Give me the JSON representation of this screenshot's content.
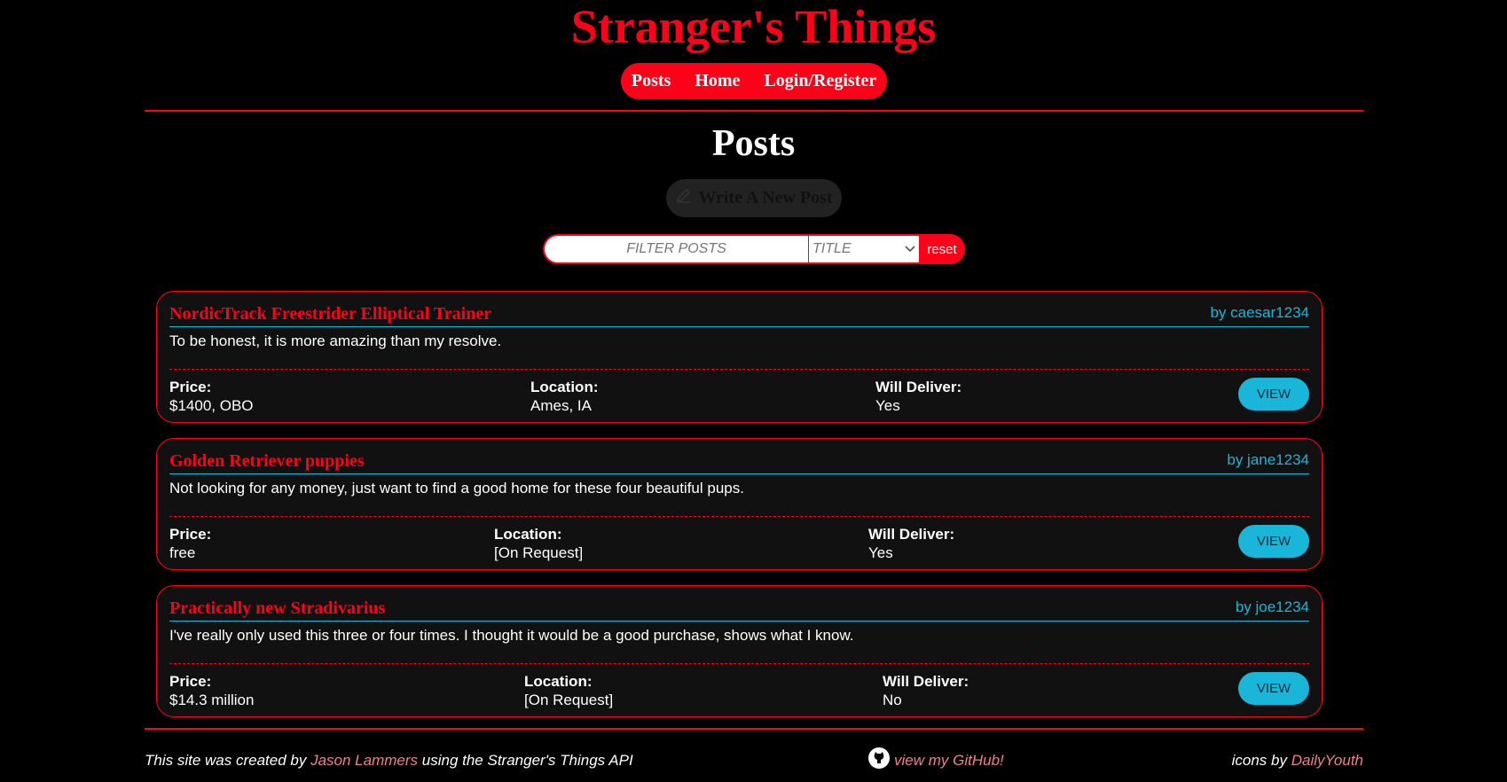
{
  "header": {
    "site_title": "Stranger's Things",
    "nav": [
      "Posts",
      "Home",
      "Login/Register"
    ]
  },
  "main": {
    "page_title": "Posts",
    "write_button": "Write A New Post",
    "filter": {
      "placeholder": "FILTER POSTS",
      "select_value": "TITLE",
      "reset_label": "reset"
    }
  },
  "posts": [
    {
      "title": "NordicTrack Freestrider Elliptical Trainer",
      "author": "by caesar1234",
      "description": "To be honest, it is more amazing than my resolve.",
      "price_label": "Price:",
      "price": "$1400, OBO",
      "location_label": "Location:",
      "location": "Ames, IA",
      "deliver_label": "Will Deliver:",
      "deliver": "Yes",
      "view_label": "VIEW"
    },
    {
      "title": "Golden Retriever puppies",
      "author": "by jane1234",
      "description": "Not looking for any money, just want to find a good home for these four beautiful pups.",
      "price_label": "Price:",
      "price": "free",
      "location_label": "Location:",
      "location": "[On Request]",
      "deliver_label": "Will Deliver:",
      "deliver": "Yes",
      "view_label": "VIEW"
    },
    {
      "title": "Practically new Stradivarius",
      "author": "by joe1234",
      "description": "I've really only used this three or four times. I thought it would be a good purchase, shows what I know.",
      "price_label": "Price:",
      "price": "$14.3 million",
      "location_label": "Location:",
      "location": "[On Request]",
      "deliver_label": "Will Deliver:",
      "deliver": "No",
      "view_label": "VIEW"
    }
  ],
  "footer": {
    "credit_prefix": "This site was created by",
    "credit_name": "Jason Lammers",
    "credit_suffix": "using the Stranger's Things API",
    "github_label": "view my GitHub!",
    "icons_prefix": "icons by",
    "icons_name": "DailyYouth"
  },
  "colors": {
    "accent_red": "#ff0019",
    "accent_cyan": "#19b6d9",
    "link_pink": "#f07f8f",
    "background": "#000000",
    "card_background": "#111111"
  },
  "icons": [
    "pencil-icon",
    "chevron-down-icon",
    "github-icon"
  ]
}
